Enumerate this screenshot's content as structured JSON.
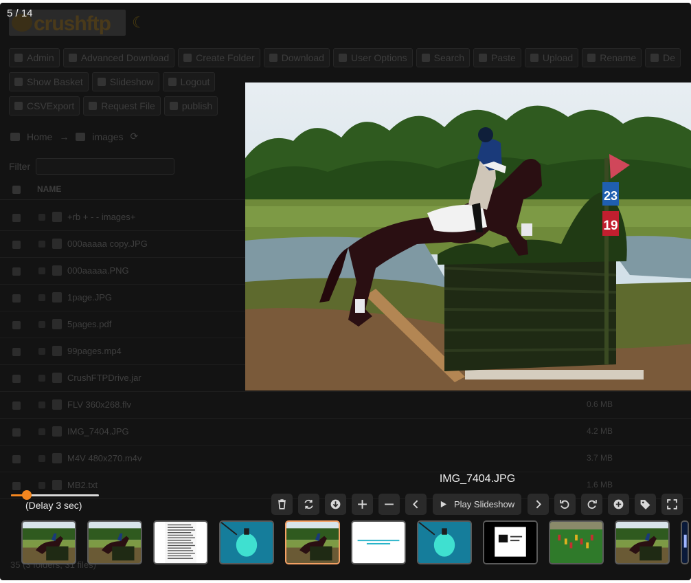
{
  "app": {
    "logo_text": "crushftp",
    "toolbar_row1": [
      "Admin",
      "Advanced Download",
      "Create Folder",
      "Download",
      "User Options",
      "Search",
      "Paste",
      "Upload",
      "Rename",
      "De"
    ],
    "toolbar_row2": [
      "Show Basket",
      "Slideshow",
      "Logout"
    ],
    "toolbar_row3": [
      "CSVExport",
      "Request File",
      "publish"
    ],
    "breadcrumb": {
      "home": "Home",
      "folder": "images"
    },
    "filter_label": "Filter",
    "table": {
      "name_header": "NAME",
      "rows": [
        {
          "name": "+rb + - - images+",
          "size": ""
        },
        {
          "name": "000aaaaa copy.JPG",
          "size": ""
        },
        {
          "name": "000aaaaa.PNG",
          "size": ""
        },
        {
          "name": "1page.JPG",
          "size": ""
        },
        {
          "name": "5pages.pdf",
          "size": ""
        },
        {
          "name": "99pages.mp4",
          "size": ""
        },
        {
          "name": "CrushFTPDrive.jar",
          "size": ""
        },
        {
          "name": "FLV 360x268.flv",
          "size": "0.6 MB"
        },
        {
          "name": "IMG_7404.JPG",
          "size": "4.2 MB"
        },
        {
          "name": "M4V 480x270.m4v",
          "size": "3.7 MB"
        },
        {
          "name": "MB2.txt",
          "size": "1.6 MB"
        }
      ]
    },
    "status": "35 (3 folders, 31 files)"
  },
  "viewer": {
    "counter": "5 / 14",
    "caption": "IMG_7404.JPG",
    "delay_label": "(Delay 3 sec)",
    "delay_fraction": 0.18,
    "play_label": "Play Slideshow",
    "photo_signs": {
      "top": "23",
      "bottom": "19"
    },
    "controls": [
      "trash-icon",
      "refresh-icon",
      "download-icon",
      "zoom-in-icon",
      "zoom-out-icon",
      "chevron-left-icon",
      "play-slideshow-button",
      "chevron-right-icon",
      "rotate-left-icon",
      "rotate-right-icon",
      "add-icon",
      "tag-icon",
      "fullscreen-icon"
    ],
    "thumbnails": [
      {
        "kind": "horse",
        "active": false
      },
      {
        "kind": "horse",
        "active": false
      },
      {
        "kind": "document",
        "active": false
      },
      {
        "kind": "cyan-lamp",
        "active": false
      },
      {
        "kind": "horse",
        "active": true
      },
      {
        "kind": "text-card",
        "active": false
      },
      {
        "kind": "cyan-lamp",
        "active": false
      },
      {
        "kind": "black-doc",
        "active": false
      },
      {
        "kind": "field",
        "active": false
      },
      {
        "kind": "horse",
        "active": false
      }
    ],
    "accent": "#f4861f",
    "active_border": "#f4a064"
  }
}
